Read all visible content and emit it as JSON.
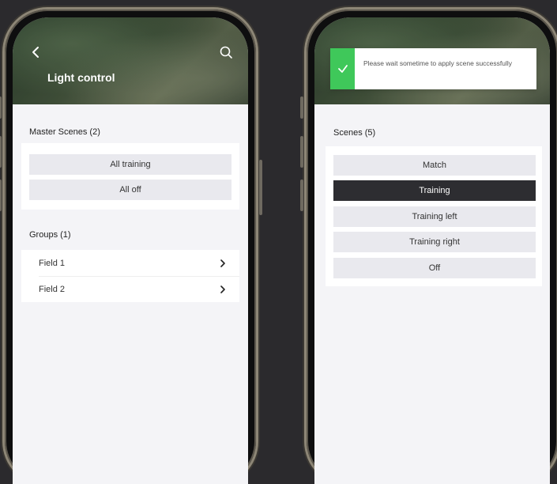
{
  "left_screen": {
    "title": "Light control",
    "master_scenes": {
      "heading": "Master Scenes (2)",
      "items": [
        "All training",
        "All off"
      ]
    },
    "groups": {
      "heading": "Groups (1)",
      "items": [
        "Field 1",
        "Field 2"
      ]
    }
  },
  "right_screen": {
    "toast": {
      "message": "Please wait sometime to apply scene successfully",
      "icon": "check-icon",
      "color": "#3fc85a"
    },
    "scenes": {
      "heading": "Scenes (5)",
      "items": [
        "Match",
        "Training",
        "Training left",
        "Training right",
        "Off"
      ],
      "selected": "Training"
    }
  },
  "colors": {
    "background": "#2b2a2d",
    "selected_scene": "#2d2d31",
    "scene_button": "#e9e9ee"
  }
}
